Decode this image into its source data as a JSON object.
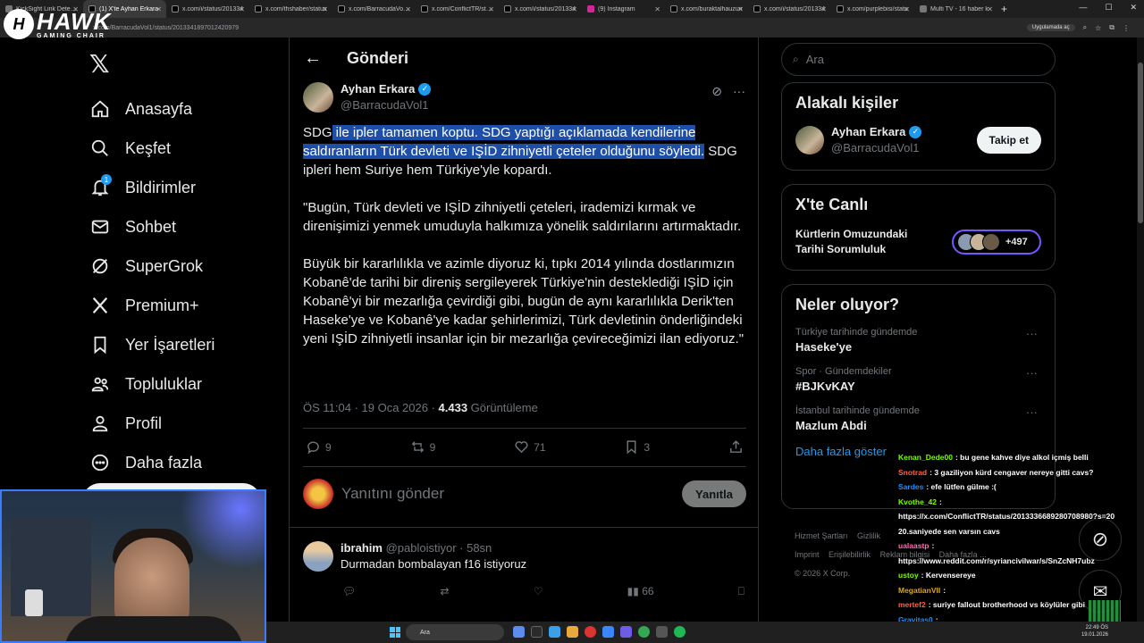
{
  "browser": {
    "tabs": [
      {
        "title": "KickSight Link Detecto"
      },
      {
        "title": "(1) X'te Ayhan Erkara"
      },
      {
        "title": "x.com/i/status/201334"
      },
      {
        "title": "x.com/thshaber/status"
      },
      {
        "title": "x.com/BarracudaVol1/s"
      },
      {
        "title": "x.com/ConflictTR/statu"
      },
      {
        "title": "x.com/i/status/201334"
      },
      {
        "title": "(9) Instagram"
      },
      {
        "title": "x.com/buraktalhauzun"
      },
      {
        "title": "x.com/i/status/201334"
      },
      {
        "title": "x.com/purplebisi/statu"
      },
      {
        "title": "Multi TV - 16 haber k"
      }
    ],
    "url": "x.com/BarracudaVol1/status/2013341897012420979",
    "app_pill": "Uygulamada aç"
  },
  "overlay": {
    "brand": "HAWK",
    "brand_sub": "GAMING CHAIR"
  },
  "nav": {
    "items": [
      {
        "label": "Anasayfa",
        "icon": "home-icon"
      },
      {
        "label": "Keşfet",
        "icon": "search-icon"
      },
      {
        "label": "Bildirimler",
        "icon": "bell-icon",
        "badge": "1"
      },
      {
        "label": "Sohbet",
        "icon": "mail-icon"
      },
      {
        "label": "SuperGrok",
        "icon": "grok-icon"
      },
      {
        "label": "Premium+",
        "icon": "x-icon"
      },
      {
        "label": "Yer İşaretleri",
        "icon": "bookmark-icon"
      },
      {
        "label": "Topluluklar",
        "icon": "people-icon"
      },
      {
        "label": "Profil",
        "icon": "person-icon"
      },
      {
        "label": "Daha fazla",
        "icon": "more-circle-icon"
      }
    ]
  },
  "main": {
    "title": "Gönderi",
    "author": {
      "name": "Ayhan Erkara",
      "handle": "@BarracudaVol1"
    },
    "post": {
      "p1_a": "SDG",
      "p1_hl": " ile ipler tamamen koptu. SDG yaptığı açıklamada kendilerine saldıranların Türk devleti ve IŞİD zihniyetli çeteler olduğunu söyledi.",
      "p1_b": " SDG ipleri hem Suriye hem Türkiye'yle kopardı.",
      "p2": "\"Bugün, Türk devleti ve IŞİD zihniyetli çeteleri, irademizi kırmak ve direnişimizi yenmek umuduyla halkımıza yönelik saldırılarını artırmaktadır.",
      "p3": "Büyük bir kararlılıkla ve azimle diyoruz ki, tıpkı 2014 yılında dostlarımızın Kobanê'de tarihi bir direniş sergileyerek Türkiye'nin desteklediği IŞİD için Kobanê'yi bir mezarlığa çevirdiği gibi, bugün de aynı kararlılıkla Derik'ten Haseke'ye ve Kobanê'ye kadar şehirlerimizi, Türk devletinin önderliğindeki yeni IŞİD zihniyetli insanlar için bir mezarlığa çevireceğimizi ilan ediyoruz.\""
    },
    "meta": {
      "time": "ÖS 11:04 · 19 Oca 2026 · ",
      "views": "4.433",
      "views_label": " Görüntüleme"
    },
    "stats": {
      "replies": "9",
      "reposts": "9",
      "likes": "71",
      "bookmarks": "3"
    },
    "reply_box": {
      "placeholder": "Yanıtını gönder",
      "button": "Yanıtla"
    },
    "reply": {
      "name": "ibrahim",
      "handle": "@pabloistiyor · 58sn",
      "text": "Durmadan bombalayan f16 istiyoruz",
      "views": "66"
    }
  },
  "right": {
    "search_placeholder": "Ara",
    "related": {
      "title": "Alakalı kişiler",
      "name": "Ayhan Erkara",
      "handle": "@BarracudaVol1",
      "follow": "Takip et"
    },
    "live": {
      "title": "X'te Canlı",
      "topic": "Kürtlerin Omuzundaki Tarihi Sorumluluk",
      "count": "+497"
    },
    "trends": {
      "title": "Neler oluyor?",
      "items": [
        {
          "context": "Türkiye tarihinde gündemde",
          "name": "Haseke'ye"
        },
        {
          "context": "Spor · Gündemdekiler",
          "name": "#BJKvKAY"
        },
        {
          "context": "İstanbul tarihinde gündemde",
          "name": "Mazlum Abdi"
        }
      ],
      "show_more": "Daha fazla göster"
    },
    "footer": [
      "Hizmet Şartları",
      "Gizlilik",
      "Imprint",
      "Erişilebilirlik",
      "Reklam bilgisi",
      "Daha fazla ...",
      "© 2026 X Corp."
    ]
  },
  "chat": [
    {
      "user": "Kenan_Dede00",
      "color": "#7CFC00",
      "msg": ": bu gene kahve diye alkol içmiş belli"
    },
    {
      "user": "Snotrad",
      "color": "#FF6347",
      "msg": ": 3 gaziliyon kürd cengaver nereye gitti cavs?"
    },
    {
      "user": "Sardes",
      "color": "#1E90FF",
      "msg": ": efe lütfen gülme :("
    },
    {
      "user": "Kvothe_42",
      "color": "#7CFC00",
      "msg": ":"
    },
    {
      "user": "",
      "color": "#fff",
      "msg": "https://x.com/ConflictTR/status/2013336689280708980?s=20 20.saniyede sen varsın cavs"
    },
    {
      "user": "ualaastp",
      "color": "#FF69B4",
      "msg": ":"
    },
    {
      "user": "",
      "color": "#fff",
      "msg": "https://www.reddit.com/r/syriancivilwar/s/SnZcNH7ubz"
    },
    {
      "user": "ustoy",
      "color": "#7CFC00",
      "msg": ": Kervensereye"
    },
    {
      "user": "MegatianVII",
      "color": "#DAA520",
      "msg": ":"
    },
    {
      "user": "mertef2",
      "color": "#FF6347",
      "msg": ": suriye fallout brotherhood vs köylüler gibi"
    },
    {
      "user": "Gravitas0",
      "color": "#1E90FF",
      "msg": ":"
    }
  ],
  "taskbar": {
    "search": "Ara",
    "time": "22:49 ÖS",
    "date": "19.01.2026"
  },
  "colors": {
    "accent": "#1d9bf0",
    "highlight": "#1e4fa8",
    "live_border": "#7856ff"
  }
}
